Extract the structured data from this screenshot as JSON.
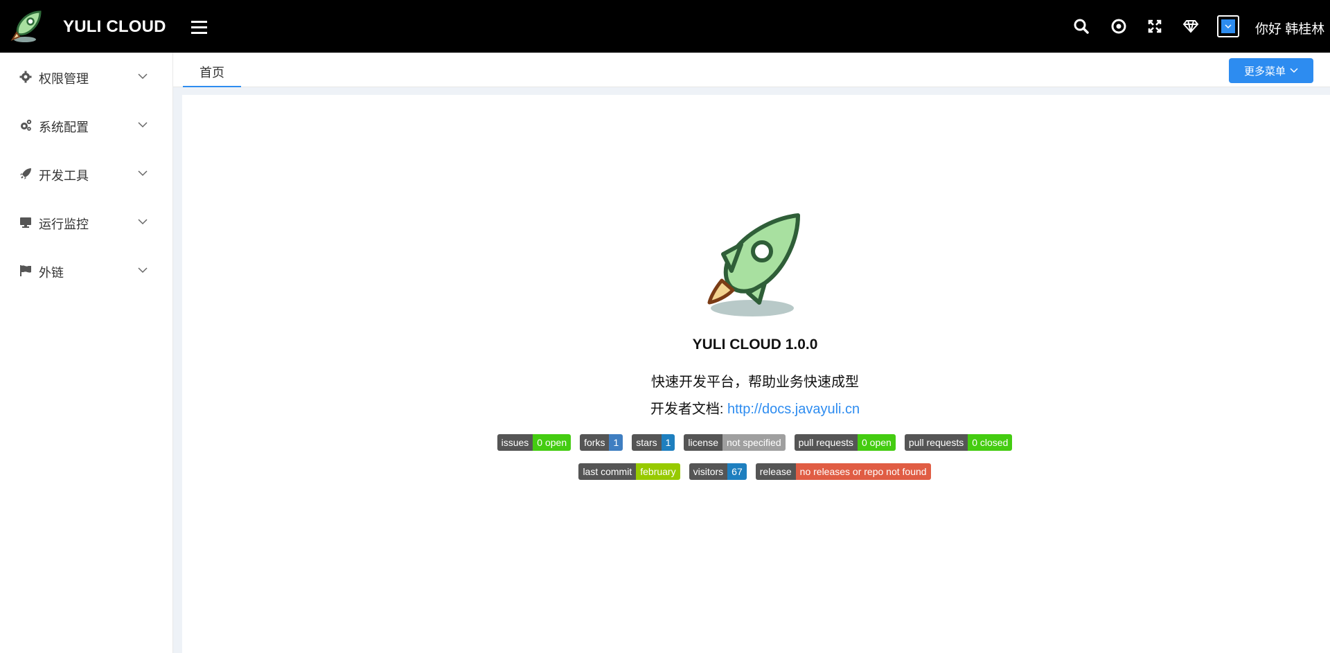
{
  "header": {
    "brand": "YULI CLOUD",
    "greeting": "你好 韩桂林",
    "icons": [
      "search-icon",
      "target-icon",
      "fullscreen-icon",
      "diamond-icon",
      "avatar-icon"
    ]
  },
  "sidebar": {
    "items": [
      {
        "label": "权限管理",
        "icon": "gear-icon"
      },
      {
        "label": "系统配置",
        "icon": "gears-icon"
      },
      {
        "label": "开发工具",
        "icon": "rocket-icon"
      },
      {
        "label": "运行监控",
        "icon": "monitor-icon"
      },
      {
        "label": "外链",
        "icon": "flag-icon"
      }
    ]
  },
  "tabs": {
    "home": "首页",
    "more": "更多菜单"
  },
  "main": {
    "title": "YULI CLOUD 1.0.0",
    "description": "快速开发平台，帮助业务快速成型",
    "docs_label": "开发者文档:",
    "docs_link": "http://docs.javayuli.cn"
  },
  "badges": {
    "row1": [
      {
        "label": "issues",
        "value": "0 open",
        "color": "#4c1"
      },
      {
        "label": "forks",
        "value": "1",
        "color": "#3f7ec1"
      },
      {
        "label": "stars",
        "value": "1",
        "color": "#1e7fbf"
      },
      {
        "label": "license",
        "value": "not specified",
        "color": "#9f9f9f"
      },
      {
        "label": "pull requests",
        "value": "0 open",
        "color": "#4c1"
      },
      {
        "label": "pull requests",
        "value": "0 closed",
        "color": "#4c1"
      }
    ],
    "row2": [
      {
        "label": "last commit",
        "value": "february",
        "color": "#97ca00"
      },
      {
        "label": "visitors",
        "value": "67",
        "color": "#1e7fbf"
      },
      {
        "label": "release",
        "value": "no releases or repo not found",
        "color": "#e05d44"
      }
    ]
  },
  "colors": {
    "accent": "#2d8cf0",
    "header_bg": "#000000"
  }
}
